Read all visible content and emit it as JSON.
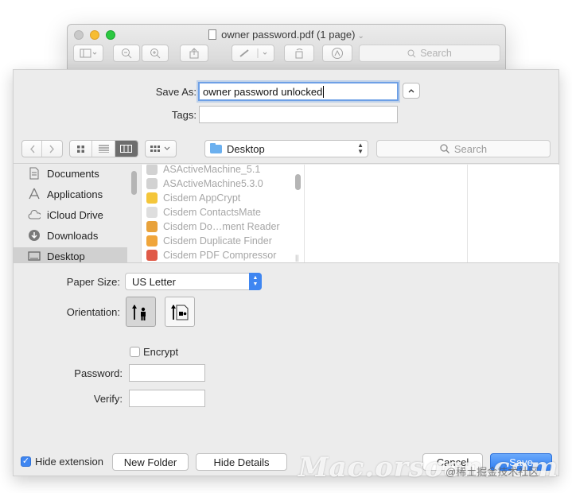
{
  "window": {
    "title": "owner password.pdf (1 page)",
    "title_chevron": "⌄",
    "toolbar_search_placeholder": "Search"
  },
  "save": {
    "save_as_label": "Save As:",
    "save_as_value": "owner password unlocked",
    "tags_label": "Tags:",
    "tags_value": ""
  },
  "nav": {
    "location": "Desktop",
    "search_placeholder": "Search",
    "back_icon": "chevron-left-icon",
    "forward_icon": "chevron-right-icon"
  },
  "sidebar": {
    "items": [
      {
        "label": "Documents",
        "icon": "documents-icon"
      },
      {
        "label": "Applications",
        "icon": "applications-icon"
      },
      {
        "label": "iCloud Drive",
        "icon": "cloud-icon"
      },
      {
        "label": "Downloads",
        "icon": "downloads-icon"
      },
      {
        "label": "Desktop",
        "icon": "desktop-icon"
      }
    ],
    "selected": "Desktop"
  },
  "files": [
    {
      "name": "ASActiveMachine_5.1",
      "color": "#c9c9c9"
    },
    {
      "name": "ASActiveMachine5.3.0",
      "color": "#c9c9c9"
    },
    {
      "name": "Cisdem AppCrypt",
      "color": "#f4c63a"
    },
    {
      "name": "Cisdem ContactsMate",
      "color": "#d9d9d9"
    },
    {
      "name": "Cisdem Do…ment Reader",
      "color": "#e8a23b"
    },
    {
      "name": "Cisdem Duplicate Finder",
      "color": "#f0a53a"
    },
    {
      "name": "Cisdem PDF Compressor",
      "color": "#e05a48"
    }
  ],
  "options": {
    "paper_size_label": "Paper Size:",
    "paper_size_value": "US Letter",
    "orientation_label": "Orientation:",
    "encrypt_label": "Encrypt",
    "encrypt_checked": false,
    "password_label": "Password:",
    "password_value": "",
    "verify_label": "Verify:",
    "verify_value": ""
  },
  "footer": {
    "hide_extension_label": "Hide extension",
    "hide_extension_checked": true,
    "new_folder_label": "New Folder",
    "hide_details_label": "Hide Details",
    "cancel_label": "Cancel",
    "save_label": "Save"
  },
  "watermark": {
    "text": "Mac.orsoon.com",
    "text2": "@稀土掘金技术社区"
  },
  "colors": {
    "accent": "#3f86f1",
    "selection": "#d0d0d0"
  }
}
